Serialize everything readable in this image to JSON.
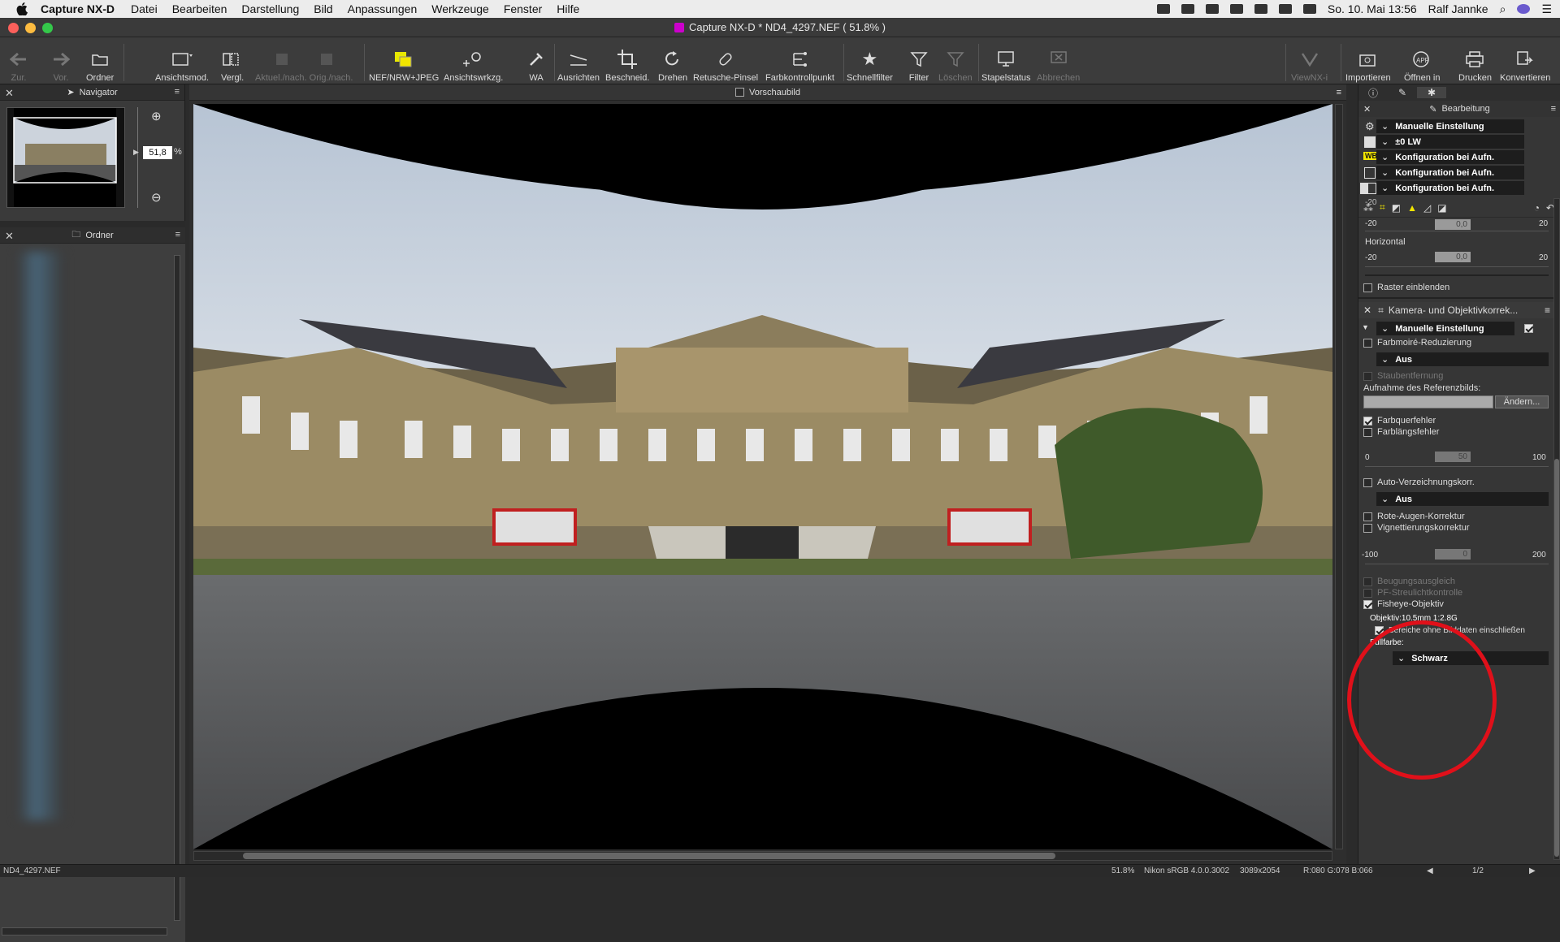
{
  "menubar": {
    "app": "Capture NX-D",
    "items": [
      "Datei",
      "Bearbeiten",
      "Darstellung",
      "Bild",
      "Anpassungen",
      "Werkzeuge",
      "Fenster",
      "Hilfe"
    ],
    "clock": "So. 10. Mai  13:56",
    "user": "Ralf Jannke"
  },
  "window": {
    "title": "Capture NX-D    * ND4_4297.NEF ( 51.8% )"
  },
  "toolbar": {
    "back": "Zur.",
    "forward": "Vor.",
    "folder": "Ordner",
    "view_mode": "Ansichtsmod.",
    "compare": "Vergl.",
    "current_orig": "Aktuel./nach. Orig./nach.",
    "nef_jpeg": "NEF/NRW+JPEG",
    "view_tool": "Ansichtswrkzg.",
    "wb": "WA",
    "straighten": "Ausrichten",
    "crop": "Beschneid.",
    "rotate": "Drehen",
    "retouch": "Retusche-Pinsel",
    "color_point": "Farbkontrollpunkt",
    "quick_filter": "Schnellfilter",
    "filter": "Filter",
    "delete": "Löschen",
    "batch": "Stapelstatus",
    "cancel": "Abbrechen",
    "viewnx": "ViewNX-i",
    "import": "Importieren",
    "open_in": "Öffnen in",
    "print": "Drucken",
    "convert": "Konvertieren"
  },
  "navigator": {
    "title": "Navigator",
    "zoom": "51,8",
    "pct": "%"
  },
  "folders": {
    "title": "Ordner"
  },
  "preview": {
    "label": "Vorschaubild"
  },
  "edit_panel": {
    "title": "Bearbeitung",
    "rows": [
      "Manuelle Einstellung",
      "±0 LW",
      "Konfiguration bei Aufn.",
      "Konfiguration bei Aufn.",
      "Konfiguration bei Aufn."
    ],
    "wb_badge": "WB",
    "vert_min": "-20",
    "vert_max": "20",
    "vert_val": "0,0",
    "horizontal": "Horizontal",
    "hor_min": "-20",
    "hor_max": "20",
    "hor_val": "0,0",
    "grid": "Raster einblenden",
    "lens_section": "Kamera- und Objektivkorrek...",
    "lens_mode": "Manuelle Einstellung",
    "moire": "Farbmoiré-Reduzierung",
    "moire_val": "Aus",
    "dust": "Staubentfernung",
    "ref_label": "Aufnahme des Referenzbilds:",
    "change": "Ändern...",
    "lat_ca": "Farbquerfehler",
    "axial_ca": "Farblängsfehler",
    "axial_min": "0",
    "axial_max": "100",
    "axial_val": "50",
    "auto_dist": "Auto-Verzeichnungskorr.",
    "dist_val": "Aus",
    "red_eye": "Rote-Augen-Korrektur",
    "vignette": "Vignettierungskorrektur",
    "vig_min": "-100",
    "vig_max": "200",
    "vig_val": "0",
    "diffraction": "Beugungsausgleich",
    "pf": "PF-Streulichtkontrolle",
    "fisheye": "Fisheye-Objektiv",
    "lens": "Objektiv:10.5mm 1:2.8G",
    "include": "Bereiche ohne Bilddaten einschließen",
    "fill_label": "Füllfarbe:",
    "fill_val": "Schwarz"
  },
  "status": {
    "file": "ND4_4297.NEF",
    "zoom": "51.8%",
    "profile": "Nikon sRGB 4.0.0.3002",
    "size": "3089x2054",
    "rgb": "R:080 G:078 B:066",
    "page": "1/2"
  },
  "colors": {
    "annotation": "#e0101a",
    "accent_yellow": "#f2e600"
  }
}
